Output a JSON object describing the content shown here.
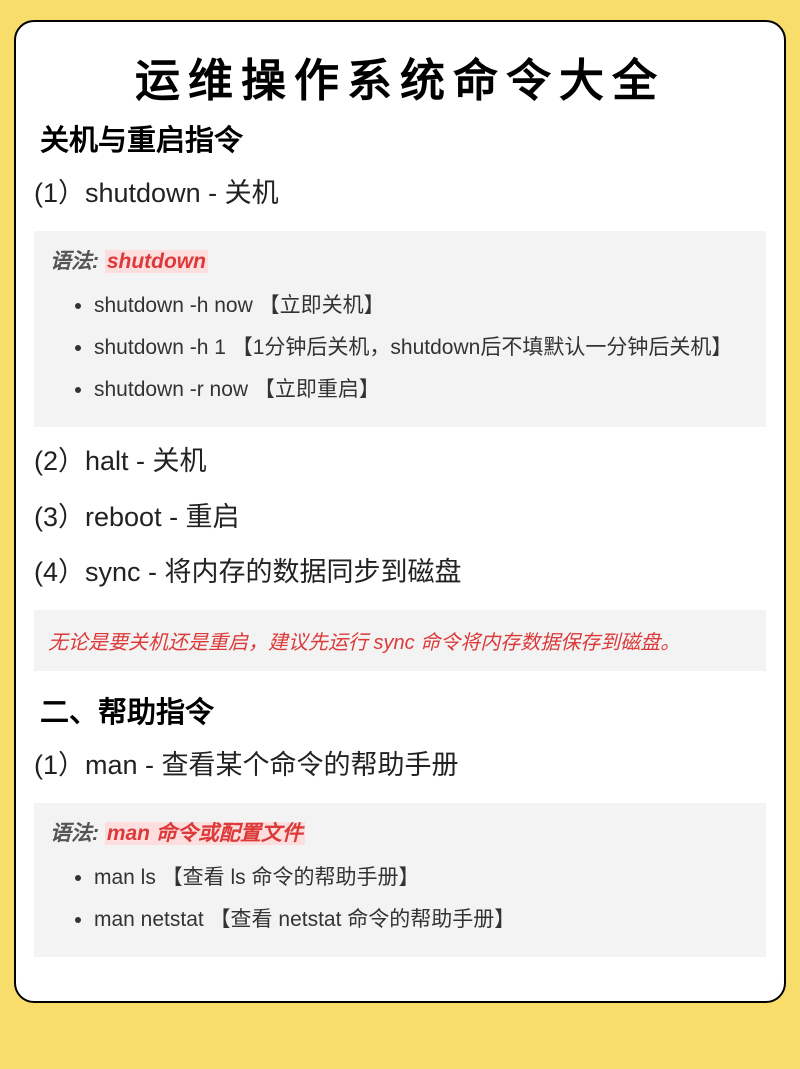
{
  "title": "运维操作系统命令大全",
  "section1": {
    "heading": "关机与重启指令",
    "items": {
      "s1": "(1）shutdown - 关机",
      "s2": "(2）halt - 关机",
      "s3": "(3）reboot - 重启",
      "s4": "(4）sync - 将内存的数据同步到磁盘"
    },
    "syntax1": {
      "label": "语法: ",
      "cmd": "shutdown",
      "bullets": [
        "shutdown -h now 【立即关机】",
        "shutdown -h 1 【1分钟后关机，shutdown后不填默认一分钟后关机】",
        "shutdown -r now 【立即重启】"
      ]
    },
    "note": "无论是要关机还是重启，建议先运行 sync 命令将内存数据保存到磁盘。"
  },
  "section2": {
    "heading": "二、帮助指令",
    "items": {
      "m1": "(1）man - 查看某个命令的帮助手册"
    },
    "syntax1": {
      "label": "语法: ",
      "cmd": "man 命令或配置文件",
      "bullets": [
        "man ls 【查看 ls 命令的帮助手册】",
        "man netstat 【查看 netstat 命令的帮助手册】"
      ]
    }
  }
}
